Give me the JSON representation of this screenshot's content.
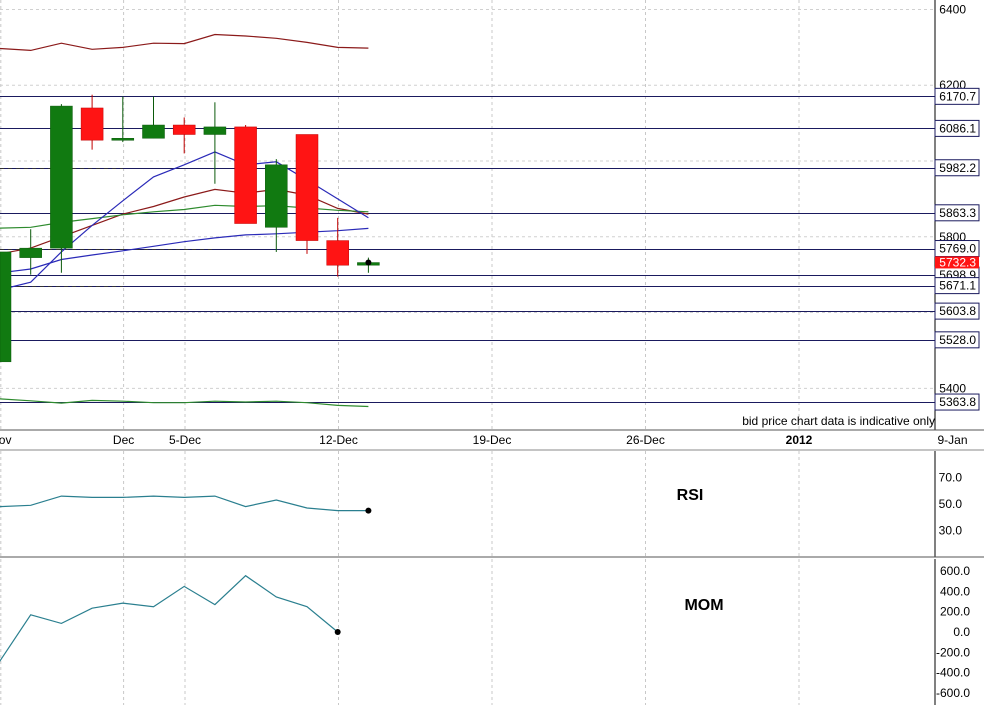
{
  "chart_data": {
    "type": "candlestick",
    "note": "bid price chart data is indicative only",
    "x_axis": {
      "tick_labels": [
        {
          "label": "Nov",
          "day": -1,
          "bold": false
        },
        {
          "label": "Dec",
          "day": 3,
          "bold": false
        },
        {
          "label": "5-Dec",
          "day": 5,
          "bold": false
        },
        {
          "label": "12-Dec",
          "day": 10,
          "bold": false
        },
        {
          "label": "19-Dec",
          "day": 15,
          "bold": false
        },
        {
          "label": "26-Dec",
          "day": 20,
          "bold": false
        },
        {
          "label": "2012",
          "day": 25,
          "bold": true
        },
        {
          "label": "9-Jan",
          "day": 30,
          "bold": false
        }
      ]
    },
    "price_panel": {
      "ylim": [
        5290,
        6425
      ],
      "y_ticks": [
        6400,
        6200,
        6000,
        5800,
        5600,
        5400
      ],
      "y_tick_labels": [
        "6400",
        "6200",
        "",
        "5800",
        "",
        "5400"
      ],
      "grid": true,
      "level_lines": [
        6170.7,
        6086.1,
        5982.2,
        5863.3,
        5769.0,
        5698.9,
        5671.1,
        5603.8,
        5528.0,
        5363.8
      ],
      "level_labels": [
        "6170.7",
        "6086.1",
        "5982.2",
        "5863.3",
        "5769.0",
        "5698.9",
        "5671.1",
        "5603.8",
        "5528.0",
        "5363.8"
      ],
      "dashed_levels": [
        {
          "value": 5982.2,
          "from_day": 0,
          "to_day": 4
        },
        {
          "value": 5769.0,
          "from_day": 0,
          "to_day": 7
        },
        {
          "value": 5671.1,
          "from_day": 0,
          "to_day": 4
        }
      ],
      "current_price_label": "5732.3",
      "candles": [
        {
          "day": 0,
          "open": 5760,
          "high": 5760,
          "low": 5470,
          "close": 5470,
          "color": "green"
        },
        {
          "day": 1,
          "open": 5745,
          "high": 5820,
          "low": 5700,
          "close": 5770,
          "color": "green"
        },
        {
          "day": 2,
          "open": 5770,
          "high": 6150,
          "low": 5705,
          "close": 6145,
          "color": "green"
        },
        {
          "day": 3,
          "open": 6140,
          "high": 6175,
          "low": 6030,
          "close": 6055,
          "color": "red"
        },
        {
          "day": 4,
          "open": 6055,
          "high": 6170,
          "low": 6050,
          "close": 6060,
          "color": "green"
        },
        {
          "day": 5,
          "open": 6060,
          "high": 6170,
          "low": 6060,
          "close": 6095,
          "color": "green"
        },
        {
          "day": 6,
          "open": 6095,
          "high": 6115,
          "low": 6020,
          "close": 6070,
          "color": "red"
        },
        {
          "day": 7,
          "open": 6070,
          "high": 6155,
          "low": 5940,
          "close": 6090,
          "color": "green"
        },
        {
          "day": 8,
          "open": 6090,
          "high": 6095,
          "low": 5835,
          "close": 5835,
          "color": "red"
        },
        {
          "day": 9,
          "open": 5825,
          "high": 6005,
          "low": 5760,
          "close": 5990,
          "color": "green"
        },
        {
          "day": 10,
          "open": 6070,
          "high": 6070,
          "low": 5755,
          "close": 5790,
          "color": "red"
        },
        {
          "day": 11,
          "open": 5790,
          "high": 5850,
          "low": 5695,
          "close": 5725,
          "color": "red"
        },
        {
          "day": 12,
          "open": 5725,
          "high": 5745,
          "low": 5705,
          "close": 5732,
          "color": "green"
        }
      ],
      "overlays": [
        {
          "name": "upper band",
          "color": "#8b1a1a",
          "points": [
            [
              -1,
              6297
            ],
            [
              0,
              6297
            ],
            [
              1,
              6292
            ],
            [
              2,
              6311
            ],
            [
              3,
              6295
            ],
            [
              4,
              6300
            ],
            [
              5,
              6311
            ],
            [
              6,
              6310
            ],
            [
              7,
              6334
            ],
            [
              8,
              6330
            ],
            [
              9,
              6324
            ],
            [
              10,
              6313
            ],
            [
              11,
              6300
            ],
            [
              12,
              6298
            ]
          ]
        },
        {
          "name": "middle band",
          "color": "#8b1a1a",
          "points": [
            [
              -1,
              5750
            ],
            [
              0,
              5755
            ],
            [
              1,
              5770
            ],
            [
              2,
              5800
            ],
            [
              3,
              5830
            ],
            [
              4,
              5860
            ],
            [
              5,
              5880
            ],
            [
              6,
              5905
            ],
            [
              7,
              5925
            ],
            [
              8,
              5915
            ],
            [
              9,
              5925
            ],
            [
              10,
              5910
            ],
            [
              11,
              5875
            ],
            [
              12,
              5860
            ]
          ]
        },
        {
          "name": "lower band",
          "color": "#2e8b2e",
          "points": [
            [
              -1,
              5375
            ],
            [
              0,
              5372
            ],
            [
              1,
              5367
            ],
            [
              2,
              5361
            ],
            [
              3,
              5368
            ],
            [
              4,
              5366
            ],
            [
              5,
              5362
            ],
            [
              6,
              5362
            ],
            [
              7,
              5366
            ],
            [
              8,
              5364
            ],
            [
              9,
              5366
            ],
            [
              10,
              5362
            ],
            [
              11,
              5355
            ],
            [
              12,
              5352
            ]
          ]
        },
        {
          "name": "green ma",
          "color": "#2e8b2e",
          "points": [
            [
              -1,
              5830
            ],
            [
              0,
              5823
            ],
            [
              1,
              5825
            ],
            [
              2,
              5838
            ],
            [
              3,
              5848
            ],
            [
              4,
              5858
            ],
            [
              5,
              5866
            ],
            [
              6,
              5872
            ],
            [
              7,
              5883
            ],
            [
              8,
              5880
            ],
            [
              9,
              5882
            ],
            [
              10,
              5876
            ],
            [
              11,
              5870
            ],
            [
              12,
              5866
            ]
          ]
        },
        {
          "name": "fast ma",
          "color": "#2a2ab8",
          "points": [
            [
              -1,
              5620
            ],
            [
              0,
              5660
            ],
            [
              1,
              5680
            ],
            [
              2,
              5760
            ],
            [
              3,
              5830
            ],
            [
              4,
              5895
            ],
            [
              5,
              5958
            ],
            [
              6,
              5990
            ],
            [
              7,
              6024
            ],
            [
              8,
              5990
            ],
            [
              9,
              5998
            ],
            [
              10,
              5950
            ],
            [
              11,
              5900
            ],
            [
              12,
              5850
            ]
          ]
        },
        {
          "name": "slow ma",
          "color": "#2a2ab8",
          "points": [
            [
              -1,
              5700
            ],
            [
              0,
              5705
            ],
            [
              1,
              5715
            ],
            [
              2,
              5740
            ],
            [
              3,
              5752
            ],
            [
              4,
              5763
            ],
            [
              5,
              5775
            ],
            [
              6,
              5787
            ],
            [
              7,
              5797
            ],
            [
              8,
              5805
            ],
            [
              9,
              5808
            ],
            [
              10,
              5812
            ],
            [
              11,
              5816
            ],
            [
              12,
              5822
            ]
          ]
        }
      ]
    },
    "rsi_panel": {
      "title": "RSI",
      "ylim": [
        10,
        90
      ],
      "y_ticks": [
        70,
        50,
        30
      ],
      "y_tick_labels": [
        "70.0",
        "50.0",
        "30.0"
      ],
      "series": {
        "color": "#2a7f8f",
        "points": [
          [
            -1,
            48
          ],
          [
            0,
            48
          ],
          [
            1,
            49
          ],
          [
            2,
            56
          ],
          [
            3,
            55
          ],
          [
            4,
            55
          ],
          [
            5,
            56
          ],
          [
            6,
            55
          ],
          [
            7,
            56
          ],
          [
            8,
            48
          ],
          [
            9,
            53
          ],
          [
            10,
            47
          ],
          [
            11,
            45
          ],
          [
            12,
            45
          ]
        ]
      }
    },
    "mom_panel": {
      "title": "MOM",
      "ylim": [
        -720,
        720
      ],
      "y_ticks": [
        600,
        400,
        200,
        0,
        -200,
        -400,
        -600
      ],
      "y_tick_labels": [
        "600.0",
        "400.0",
        "200.0",
        "0.0",
        "-200.0",
        "-400.0",
        "-600.0"
      ],
      "series": {
        "color": "#2a7f8f",
        "points": [
          [
            -1,
            -150
          ],
          [
            0,
            -285
          ],
          [
            1,
            170
          ],
          [
            2,
            85
          ],
          [
            3,
            235
          ],
          [
            4,
            285
          ],
          [
            5,
            250
          ],
          [
            6,
            450
          ],
          [
            7,
            270
          ],
          [
            8,
            555
          ],
          [
            9,
            345
          ],
          [
            10,
            250
          ],
          [
            11,
            0
          ]
        ]
      }
    }
  }
}
